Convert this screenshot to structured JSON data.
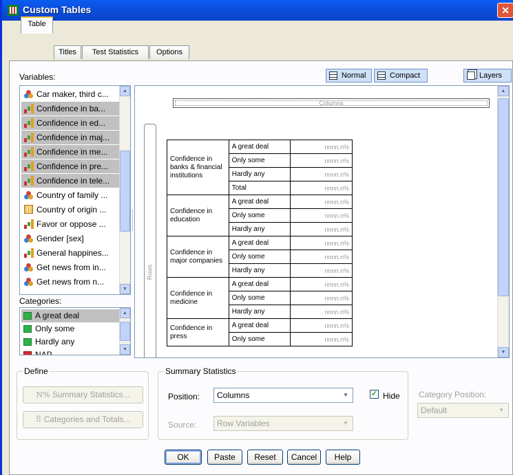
{
  "window": {
    "title": "Custom Tables",
    "close_glyph": "✕"
  },
  "tabs": [
    {
      "label": "Table"
    },
    {
      "label": "Titles"
    },
    {
      "label": "Test Statistics"
    },
    {
      "label": "Options"
    }
  ],
  "variables_label": "Variables:",
  "view_buttons": {
    "normal": "Normal",
    "compact": "Compact",
    "layers": "Layers"
  },
  "variables": [
    {
      "label": "Car maker, third c...",
      "icon": "nominal-icon",
      "selected": false
    },
    {
      "label": "Confidence in ba...",
      "icon": "ordinal-icon",
      "selected": true
    },
    {
      "label": "Confidence in ed...",
      "icon": "ordinal-icon",
      "selected": true
    },
    {
      "label": "Confidence in maj...",
      "icon": "ordinal-icon",
      "selected": true
    },
    {
      "label": "Confidence in me...",
      "icon": "ordinal-icon",
      "selected": true
    },
    {
      "label": "Confidence in pre...",
      "icon": "ordinal-icon",
      "selected": true
    },
    {
      "label": "Confidence in tele...",
      "icon": "ordinal-icon",
      "selected": true
    },
    {
      "label": "Country of family ...",
      "icon": "nominal-icon",
      "selected": false
    },
    {
      "label": "Country of origin ...",
      "icon": "scale-icon",
      "selected": false
    },
    {
      "label": "Favor or oppose ...",
      "icon": "ordinal-icon",
      "selected": false
    },
    {
      "label": "Gender [sex]",
      "icon": "nominal-icon",
      "selected": false
    },
    {
      "label": "General happines...",
      "icon": "ordinal-icon",
      "selected": false
    },
    {
      "label": "Get news from in...",
      "icon": "nominal-icon",
      "selected": false
    },
    {
      "label": "Get news from n...",
      "icon": "nominal-icon",
      "selected": false
    }
  ],
  "categories_label": "Categories:",
  "categories": [
    {
      "label": "A great deal",
      "selected": true
    },
    {
      "label": "Only some",
      "selected": false
    },
    {
      "label": "Hardly any",
      "selected": false
    },
    {
      "label": "NAP",
      "selected": false
    }
  ],
  "canvas": {
    "columns_label": "Columns",
    "rows_label": "Rows",
    "placeholder": "nnnn.n%",
    "groups": [
      {
        "label": "Confidence in banks & financial institutions",
        "cats": [
          "A great deal",
          "Only some",
          "Hardly any",
          "Total"
        ]
      },
      {
        "label": "Confidence in education",
        "cats": [
          "A great deal",
          "Only some",
          "Hardly any"
        ]
      },
      {
        "label": "Confidence in major companies",
        "cats": [
          "A great deal",
          "Only some",
          "Hardly any"
        ]
      },
      {
        "label": "Confidence in medicine",
        "cats": [
          "A great deal",
          "Only some",
          "Hardly any"
        ]
      },
      {
        "label": "Confidence in press",
        "cats": [
          "A great deal",
          "Only some"
        ]
      }
    ]
  },
  "define": {
    "label": "Define",
    "summary_button": "Summary Statistics...",
    "categories_button": "Categories and Totals..."
  },
  "summary_stats": {
    "label": "Summary Statistics",
    "position_label": "Position:",
    "position_value": "Columns",
    "source_label": "Source:",
    "source_value": "Row Variables",
    "hide_label": "Hide",
    "hide_checked": true
  },
  "category_position": {
    "label": "Category Position:",
    "value": "Default"
  },
  "footer_buttons": {
    "ok": "OK",
    "paste": "Paste",
    "reset": "Reset",
    "cancel": "Cancel",
    "help": "Help"
  }
}
